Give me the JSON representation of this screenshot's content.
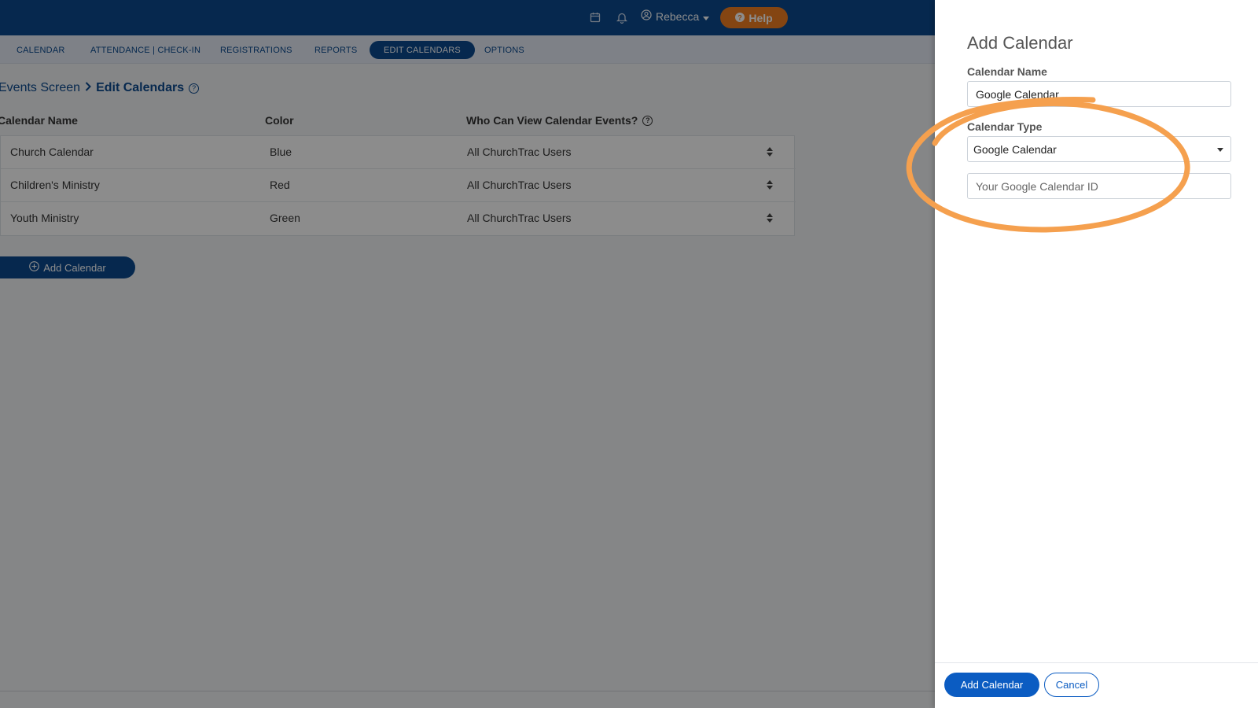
{
  "topbar": {
    "user_name": "Rebecca",
    "help_label": "Help"
  },
  "nav": {
    "items": [
      "CALENDAR",
      "ATTENDANCE | CHECK-IN",
      "REGISTRATIONS",
      "REPORTS",
      "EDIT CALENDARS",
      "OPTIONS"
    ],
    "active": "EDIT CALENDARS"
  },
  "breadcrumb": {
    "parent": "Events Screen",
    "current": "Edit Calendars"
  },
  "table": {
    "headers": [
      "Calendar Name",
      "Color",
      "Who Can View Calendar Events?"
    ],
    "rows": [
      {
        "name": "Church Calendar",
        "color": "Blue",
        "who": "All ChurchTrac Users"
      },
      {
        "name": "Children's Ministry",
        "color": "Red",
        "who": "All ChurchTrac Users"
      },
      {
        "name": "Youth Ministry",
        "color": "Green",
        "who": "All ChurchTrac Users"
      }
    ]
  },
  "add_calendar_label": "Add Calendar",
  "panel": {
    "title": "Add Calendar",
    "name_label": "Calendar Name",
    "name_value": "Google Calendar",
    "type_label": "Calendar Type",
    "type_value": "Google Calendar",
    "id_placeholder": "Your Google Calendar ID",
    "submit_label": "Add Calendar",
    "cancel_label": "Cancel"
  },
  "colors": {
    "brand_blue": "#0b4a8f",
    "help_orange": "#f07f22",
    "annotation_orange": "#f5a04e",
    "primary_button": "#0b5cc2"
  },
  "icons": {
    "topbar": [
      "calendar-icon",
      "bell-icon",
      "user-circle-icon",
      "chevron-down-icon",
      "help-icon"
    ],
    "table": [
      "sort-icon",
      "question-icon"
    ],
    "add": "plus-circle-icon"
  }
}
